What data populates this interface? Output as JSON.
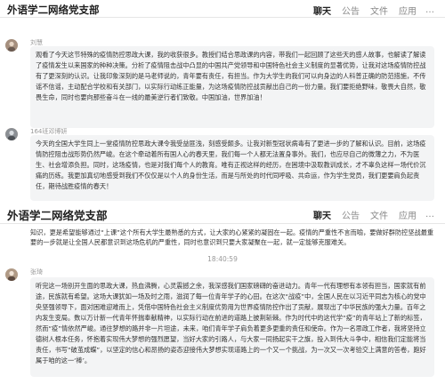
{
  "header": {
    "title": "外语学二网络党支部",
    "tabs": [
      {
        "label": "聊天",
        "active": true
      },
      {
        "label": "公告",
        "active": false
      },
      {
        "label": "文件",
        "active": false
      },
      {
        "label": "应用",
        "active": false
      }
    ],
    "more_icon": "…"
  },
  "header_repeat": {
    "title": "外语学二网络党支部",
    "tabs": [
      {
        "label": "聊天",
        "active": true
      },
      {
        "label": "公告",
        "active": false
      },
      {
        "label": "文件",
        "active": false
      },
      {
        "label": "应用",
        "active": false
      }
    ],
    "more_icon": "…"
  },
  "messages": [
    {
      "sender": "刘慧",
      "text": "观看了今天这节特殊的疫情防控思政大课，我的收获很多。教授们结合思政课的内容，带我们一起回顾了这些天的感人故事，也解读了解读了疫情发生以来国家的种种决策。分析了疫情阻击战中凸显的中国共产党领导和中国特色社会主义制度的显著优势，让我对这场疫情防控战有了更深刻的认识。让我印象深刻的是马老师说的，青年要有责任，有担当。作为大学生的我们可以向身边的人科普正确的防范措施，不传谣不信谣，主动配合学校和有关部门，以实际行动练正能量，为这场疫情防控战贡献出自己的一份力量。我们要拒绝野味，敬畏大自然，敬畏生命，同时也要向那些奋斗在一线的最美逆行者们致敬。中国加油，世界加油！"
    },
    {
      "sender": "164班邓博妍",
      "text": "今天的全国大学生同上一堂疫情防控思政大课令我受益匪浅，刻感受颇多。让我对新型冠状病毒有了更进一步的了解和认识。目前，这场疫情防控阻击战形势仍然严峻。在这个牵动着所有国人心的春天里，我们每一个人都无法置身事外。我们，也应尽自己的微薄之力，不为医生、社会增添负担。同时，这场疫情，也是对我们每个人的教育。唯有正视这样的经历，在困境中汲取教训成长，才不辜负这样一场代价沉痛的历练。我更加真切地感受到我们不仅仅是以个人的身份生活，而是与所处的时代同呼吸、共命运，作为学生党员，我们更要肩负起责任，期待战胜疫情的春天！"
    },
    {
      "sender": "",
      "text": "知识，更是希望能够通过“上课”这个所有大学生最熟悉的方式，让大家的心紧紧的凝固在一起。疫情的严重性不言而喻，要做好群防控坚战最重要的一步就是让全国人民都意识到这场危机的严重性，同时也意识到只要大家凝聚在一起，就一定能够克服难关。"
    },
    {
      "sender": "张琦",
      "text": "听完这一场别开生面的思政大课，热血沸腾，心灵震撼之余，我深感我们国家磅礴的奋进动力。青年一代有理想有本领有担当，国家就有前途，民族就有希望。这场大课犹如一场及时之雨，滋润了每一位青年学子的心田。在这次“战疫”中，全国人民在以习近平同志为核心的党中央坚强领导下，面对困难迎难而上，凭借中国特色社会主义制度优势用为世界疫情防控作出了贡献，展现出了中华民族的强大力量。百年之内发生变局。数以万计新一代青年怀揣奉献精神，以实际行动在前进的道路上披荆斩棘。作为时代中的这代学“疫”的青年站上了新的标签，然而“疫”情依然严峻。通往梦想的路并非一片坦途，未来，咱们青年学子肩负着更多更重的责任和使命。作为一名思政工作者，我将坚持立德树人根本任务，怀抱着实现伟大梦想的强烈愿望，当好大家的引路人，与大家一同扬起实干之旗，投入到伟大斗争中，相信我们定能将当责任，书写“破茧成蝶”，以坚定的信心和昂扬的姿态迎接伟大梦想实现道路上的一个又一个挑战，为一次又一次考验交上满意的答卷，跑好属于咱的这一‘棒’。"
    }
  ],
  "timestamp": "18:40:59"
}
